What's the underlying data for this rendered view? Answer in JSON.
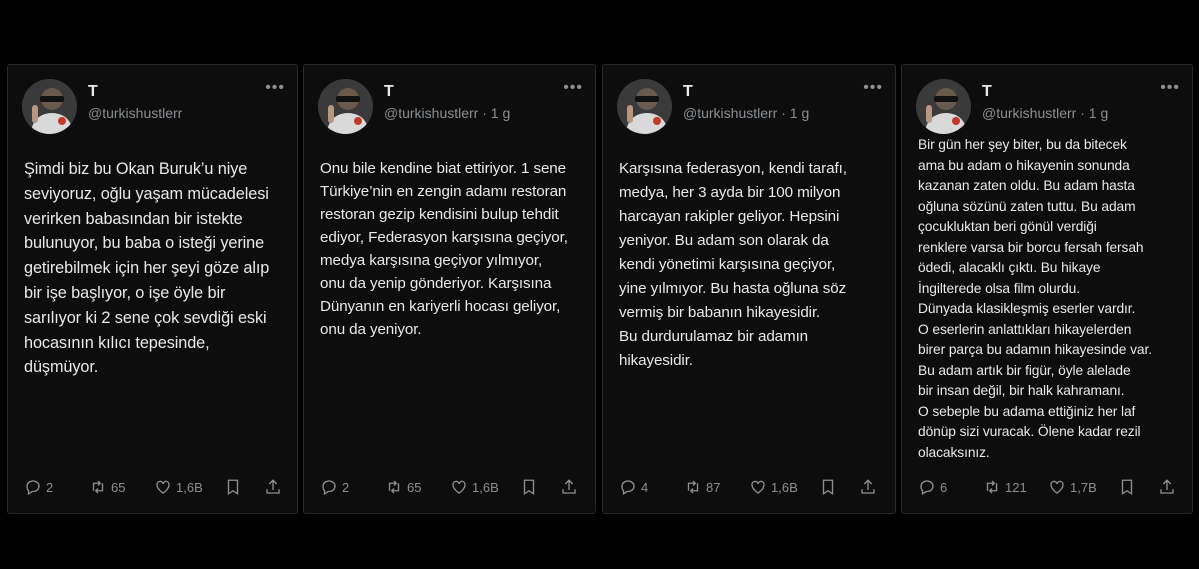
{
  "tweets": [
    {
      "name": "T",
      "handle": "@turkishustlerr",
      "text": "Şimdi biz bu Okan Buruk’u niye\nseviyoruz, oğlu yaşam mücadelesi\nverirken babasından bir istekte\nbulunuyor, bu baba o isteği yerine\ngetirebilmek için her şeyi göze alıp\nbir işe başlıyor, o işe öyle bir\nsarılıyor ki 2 sene çok sevdiği eski\nhocasının kılıcı tepesinde,\ndüşmüyor.",
      "replies": "2",
      "retweets": "65",
      "likes": "1,6B"
    },
    {
      "name": "T",
      "handle": "@turkishustlerr · 1 g",
      "text": "Onu bile kendine biat ettiriyor. 1 sene\nTürkiye’nin en zengin adamı restoran\nrestoran gezip kendisini bulup tehdit\nediyor, Federasyon karşısına geçiyor,\nmedya karşısına geçiyor yılmıyor,\nonu da yenip gönderiyor. Karşısına\nDünyanın en kariyerli hocası geliyor,\nonu da yeniyor.",
      "replies": "2",
      "retweets": "65",
      "likes": "1,6B"
    },
    {
      "name": "T",
      "handle": "@turkishustlerr · 1 g",
      "text": "Karşısına federasyon, kendi tarafı,\nmedya, her 3 ayda bir 100 milyon\nharcayan rakipler geliyor. Hepsini\nyeniyor. Bu adam son olarak da\nkendi yönetimi karşısına geçiyor,\nyine yılmıyor. Bu hasta oğluna söz\nvermiş bir babanın hikayesidir.\nBu durdurulamaz bir adamın\nhikayesidir.",
      "replies": "4",
      "retweets": "87",
      "likes": "1,6B"
    },
    {
      "name": "T",
      "handle": "@turkishustlerr · 1 g",
      "text": "Bir gün her şey biter, bu da bitecek\nama bu adam o hikayenin sonunda\nkazanan zaten oldu. Bu adam hasta\noğluna sözünü zaten tuttu. Bu adam\nçocukluktan beri gönül verdiği\nrenklere varsa bir borcu fersah fersah\nödedi, alacaklı çıktı. Bu hikaye\nİngilterede olsa film olurdu.\nDünyada klasikleşmiş eserler vardır.\nO eserlerin anlattıkları hikayelerden\nbirer parça bu adamın hikayesinde var.\nBu adam artık bir figür, öyle alelade\nbir insan değil, bir halk kahramanı.\nO sebeple bu adama ettiğiniz her laf\ndönüp sizi vuracak. Ölene kadar rezil\nolacaksınız.",
      "replies": "6",
      "retweets": "121",
      "likes": "1,7B"
    }
  ],
  "icons": {
    "more": "more-horizontal-icon",
    "reply": "reply-icon",
    "retweet": "retweet-icon",
    "like": "heart-icon",
    "bookmark": "bookmark-icon",
    "share": "share-icon"
  },
  "colors": {
    "background": "#000000",
    "card": "#0d0d0d",
    "text": "#e7e9ea",
    "muted": "#8b8f93"
  }
}
